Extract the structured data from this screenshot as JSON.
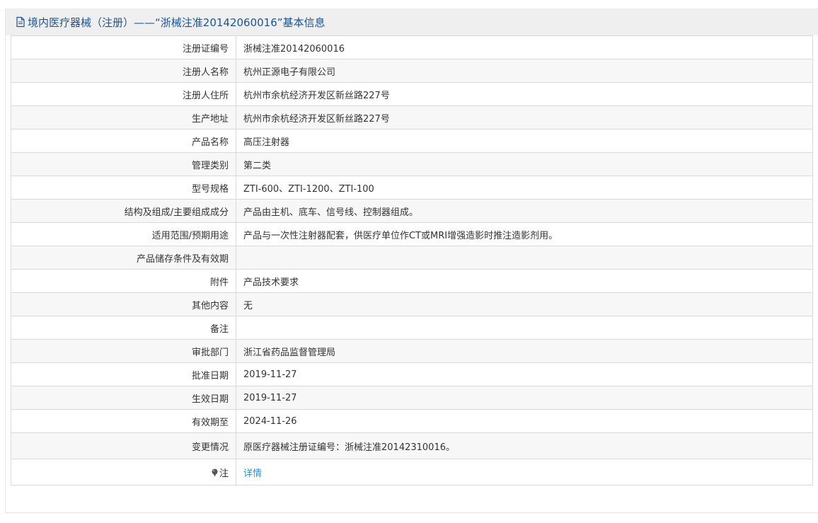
{
  "header": {
    "title": "境内医疗器械（注册）——“浙械注准20142060016”基本信息",
    "icon": "document-icon"
  },
  "rows": [
    {
      "label": "注册证编号",
      "value": "浙械注准20142060016"
    },
    {
      "label": "注册人名称",
      "value": "杭州正源电子有限公司"
    },
    {
      "label": "注册人住所",
      "value": "杭州市余杭经济开发区新丝路227号"
    },
    {
      "label": "生产地址",
      "value": "杭州市余杭经济开发区新丝路227号"
    },
    {
      "label": "产品名称",
      "value": "高压注射器"
    },
    {
      "label": "管理类别",
      "value": "第二类"
    },
    {
      "label": "型号规格",
      "value": "ZTI-600、ZTI-1200、ZTI-100"
    },
    {
      "label": "结构及组成/主要组成成分",
      "value": "产品由主机、底车、信号线、控制器组成。"
    },
    {
      "label": "适用范围/预期用途",
      "value": "产品与一次性注射器配套，供医疗单位作CT或MRI增强造影时推注造影剂用。"
    },
    {
      "label": "产品储存条件及有效期",
      "value": ""
    },
    {
      "label": "附件",
      "value": "产品技术要求"
    },
    {
      "label": "其他内容",
      "value": "无"
    },
    {
      "label": "备注",
      "value": ""
    },
    {
      "label": "审批部门",
      "value": "浙江省药品监督管理局"
    },
    {
      "label": "批准日期",
      "value": "2019-11-27"
    },
    {
      "label": "生效日期",
      "value": "2019-11-27"
    },
    {
      "label": "有效期至",
      "value": "2024-11-26"
    },
    {
      "label": "变更情况",
      "value": "原医疗器械注册证编号：浙械注准20142310016。"
    }
  ],
  "note_row": {
    "label": "注",
    "icon": "pin-icon",
    "link_text": "详情"
  },
  "colors": {
    "header_bg": "#efefef",
    "header_text": "#1e5494",
    "link": "#2b8fd1",
    "border": "#d9d9d9"
  }
}
